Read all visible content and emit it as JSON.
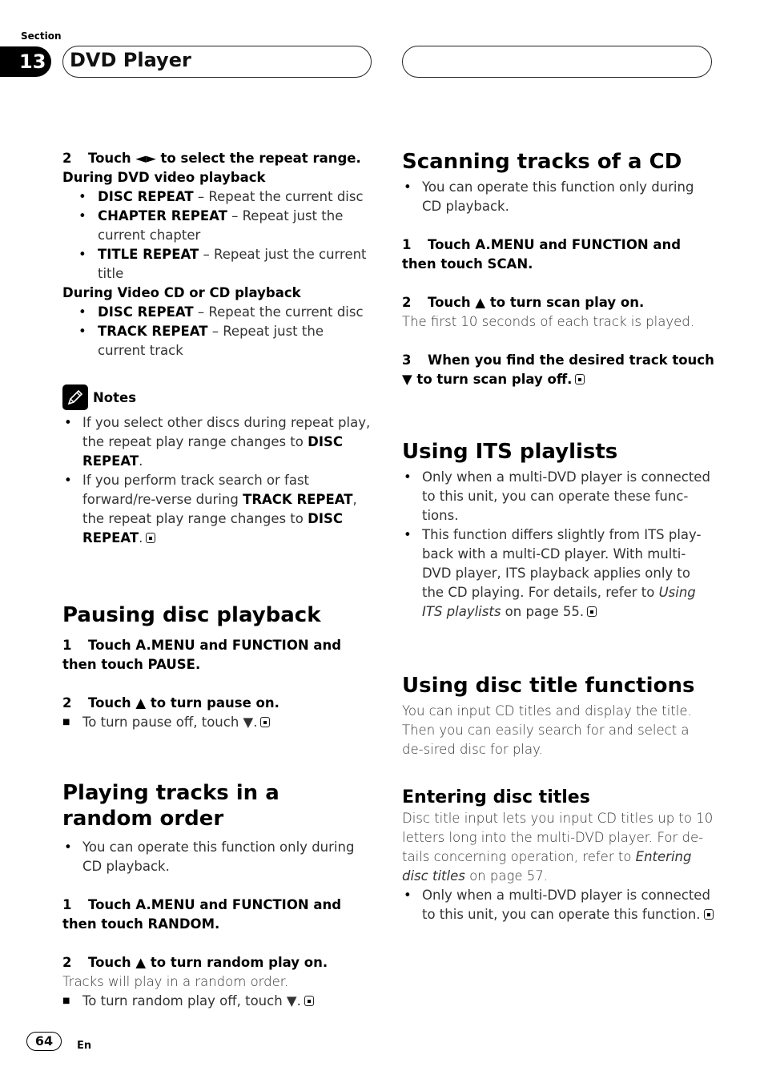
{
  "header": {
    "section_label": "Section",
    "section_number": "13",
    "chapter_title": "DVD Player"
  },
  "left": {
    "repeat_step2": {
      "num": "2",
      "text": "Touch ◄► to select the repeat range."
    },
    "dvd_heading": "During DVD video playback",
    "dvd_items": [
      {
        "term": "DISC REPEAT",
        "desc": " – Repeat the current disc"
      },
      {
        "term": "CHAPTER REPEAT",
        "desc": " – Repeat just the current chapter"
      },
      {
        "term": "TITLE REPEAT",
        "desc": " – Repeat just the current title"
      }
    ],
    "vcd_heading": "During Video CD or CD playback",
    "vcd_items": [
      {
        "term": "DISC REPEAT",
        "desc": " – Repeat the current disc"
      },
      {
        "term": "TRACK REPEAT",
        "desc": " – Repeat just the current track"
      }
    ],
    "notes": {
      "label": "Notes",
      "note1_text": "If you select other discs during repeat play, the repeat play range changes to ",
      "note1_bold": "DISC REPEAT",
      "note1_end": ".",
      "note2_a": "If you perform track search or fast forward/re-verse during ",
      "note2_bold1": "TRACK REPEAT",
      "note2_b": ", the repeat play range changes to ",
      "note2_bold2": "DISC REPEAT",
      "note2_end": "."
    },
    "pausing": {
      "title": "Pausing disc playback",
      "step1": {
        "num": "1",
        "text": "Touch A.MENU and FUNCTION and then touch PAUSE."
      },
      "step2": {
        "num": "2",
        "text": "Touch ▲ to turn pause on."
      },
      "tip": "To turn pause off, touch ▼."
    },
    "random": {
      "title": "Playing tracks in a random order",
      "bullet": "You can operate this function only during CD playback.",
      "step1": {
        "num": "1",
        "text": "Touch A.MENU and FUNCTION and then touch RANDOM."
      },
      "step2": {
        "num": "2",
        "text": "Touch ▲ to turn random play on."
      },
      "body": "Tracks will play in a random order.",
      "tip": "To turn random play off, touch ▼."
    }
  },
  "right": {
    "scanning": {
      "title": "Scanning tracks of a CD",
      "bullet": "You can operate this function only during CD playback.",
      "step1": {
        "num": "1",
        "text": "Touch A.MENU and FUNCTION and then touch SCAN."
      },
      "step2": {
        "num": "2",
        "text": "Touch ▲ to turn scan play on."
      },
      "body": "The first 10 seconds of each track is played.",
      "step3": {
        "num": "3",
        "text": "When you find the desired track touch ▼ to turn scan play off."
      }
    },
    "its": {
      "title": "Using ITS playlists",
      "bullet1": "Only when a multi-DVD player is connected to this unit, you can operate these func-tions.",
      "bullet2_a": "This function differs slightly from ITS play-back with a multi-CD player. With multi-DVD player, ITS playback applies only to the CD playing. For details, refer to ",
      "bullet2_link": "Using ITS playlists",
      "bullet2_b": " on page 55."
    },
    "disc_title": {
      "title": "Using disc title functions",
      "body": "You can input CD titles and display the title. Then you can easily search for and select a de-sired disc for play.",
      "sub_title": "Entering disc titles",
      "sub_body_a": "Disc title input lets you input CD titles up to 10 letters long into the multi-DVD player. For de-tails concerning operation, refer to ",
      "sub_body_link": "Entering disc titles",
      "sub_body_b": " on page 57.",
      "bullet": "Only when a multi-DVD player is connected to this unit, you can operate this function."
    }
  },
  "footer": {
    "page_number": "64",
    "language": "En"
  }
}
